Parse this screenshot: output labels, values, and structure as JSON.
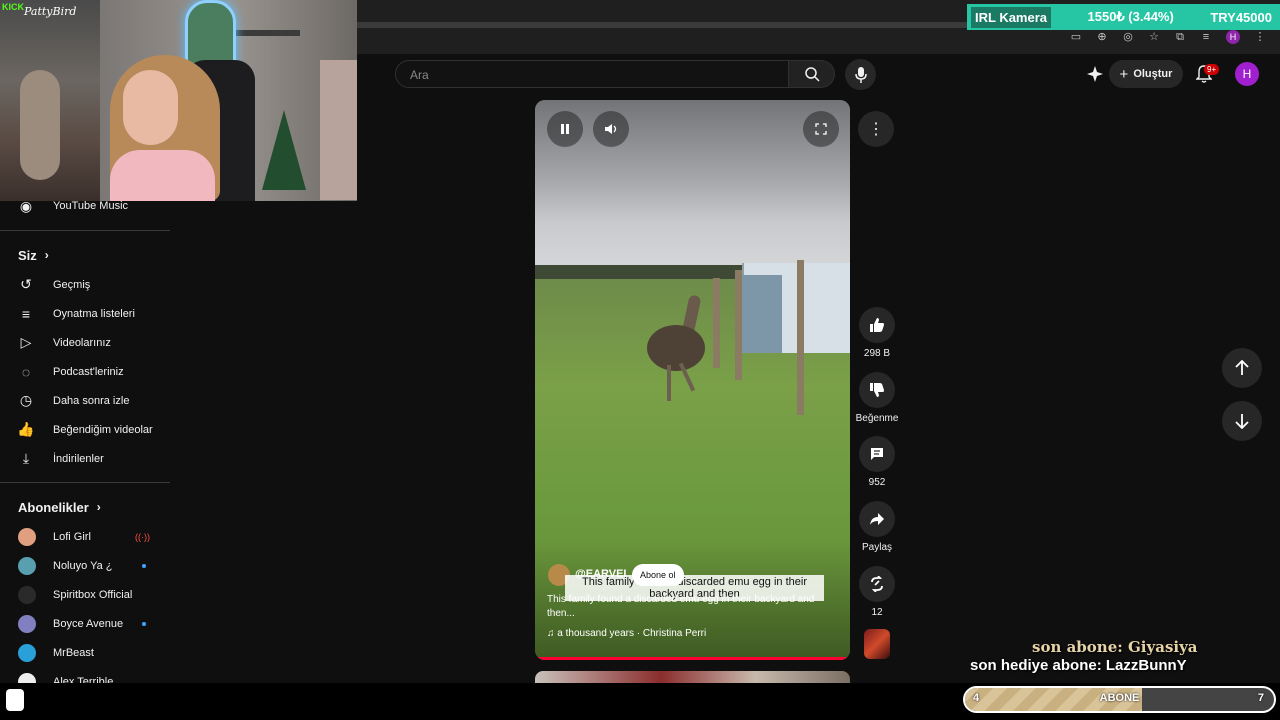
{
  "ticker": {
    "label": "IRL Kamera",
    "price": "1550₺ (3.44%)",
    "goal": "TRY45000"
  },
  "webcam": {
    "logo_text": "KICK",
    "signature": "PattyBird"
  },
  "search": {
    "placeholder": "Ara"
  },
  "header": {
    "create_label": "Oluştur",
    "notif_count": "9+",
    "avatar_letter": "H",
    "browser_avatar": "H"
  },
  "sidebar": {
    "top_item": {
      "label": "YouTube Music",
      "icon": "youtube-music-icon"
    },
    "you_heading": "Siz",
    "you_items": [
      {
        "label": "Geçmiş",
        "icon": "history-icon"
      },
      {
        "label": "Oynatma listeleri",
        "icon": "playlists-icon"
      },
      {
        "label": "Videolarınız",
        "icon": "your-videos-icon"
      },
      {
        "label": "Podcast'leriniz",
        "icon": "podcast-icon"
      },
      {
        "label": "Daha sonra izle",
        "icon": "watch-later-icon"
      },
      {
        "label": "Beğendiğim videolar",
        "icon": "liked-videos-icon"
      },
      {
        "label": "İndirilenler",
        "icon": "downloads-icon"
      }
    ],
    "subs_heading": "Abonelikler",
    "subscriptions": [
      {
        "name": "Lofi Girl",
        "avatar_color": "#e0a080",
        "badge": "live"
      },
      {
        "name": "Noluyo Ya ¿",
        "avatar_color": "#58a0b0",
        "badge": "dot"
      },
      {
        "name": "Spiritbox Official",
        "avatar_color": "#2a2a2a",
        "badge": ""
      },
      {
        "name": "Boyce Avenue",
        "avatar_color": "#8080c0",
        "badge": "dot"
      },
      {
        "name": "MrBeast",
        "avatar_color": "#2aa0d8",
        "badge": ""
      },
      {
        "name": "Alex Terrible",
        "avatar_color": "#eeeeee",
        "badge": ""
      }
    ]
  },
  "video": {
    "channel": "@EARVEI",
    "subscribe_label": "Abone ol",
    "caption": "This family found a discarded emu egg in their backyard and then",
    "title": "This family found a discarded emu egg in their backyard and then...",
    "song": "a thousand years · Christina Perri",
    "progress": 0.99
  },
  "actions": {
    "likes": "298 B",
    "dislike_label": "Beğenme",
    "comments": "952",
    "share_label": "Paylaş",
    "remix_count": "12"
  },
  "overlay": {
    "last_sub": "son abone: Giyasiya",
    "last_gift": "son hediye abone: LazzBunnY",
    "goal_label": "ABONE",
    "goal_current": "4",
    "goal_target": "7"
  },
  "colors": {
    "accent": "#ff0033",
    "ticker": "#26c6a4",
    "kick_green": "#53fc18"
  }
}
